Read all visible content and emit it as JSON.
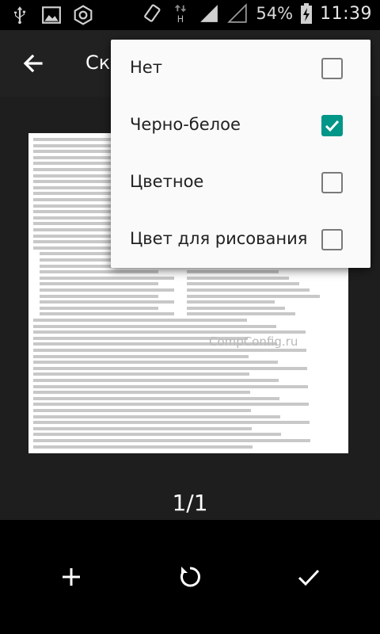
{
  "status_bar": {
    "icons_left": [
      "usb-icon",
      "image-icon",
      "hexagon-nut-icon"
    ],
    "icons_right": [
      "rotate-phone-icon",
      "data-h-icon",
      "signal-strong-icon",
      "signal-empty-icon",
      "battery-charging-icon"
    ],
    "data_indicator": "H",
    "battery_percent": "54%",
    "time": "11:39"
  },
  "app_bar": {
    "title": "Ск"
  },
  "preview": {
    "watermark": "CompConfig.ru",
    "page_counter": "1/1"
  },
  "menu": {
    "items": [
      {
        "label": "Нет",
        "checked": false
      },
      {
        "label": "Черно-белое",
        "checked": true
      },
      {
        "label": "Цветное",
        "checked": false
      },
      {
        "label": "Цвет для рисования",
        "checked": false
      }
    ]
  },
  "bottom_bar": {
    "actions": [
      "add-icon",
      "rotate-icon",
      "confirm-check-icon"
    ]
  },
  "colors": {
    "accent": "#009688",
    "app_bar": "#212121",
    "preview_bg": "#1e1e1e",
    "menu_bg": "#fafafa"
  }
}
